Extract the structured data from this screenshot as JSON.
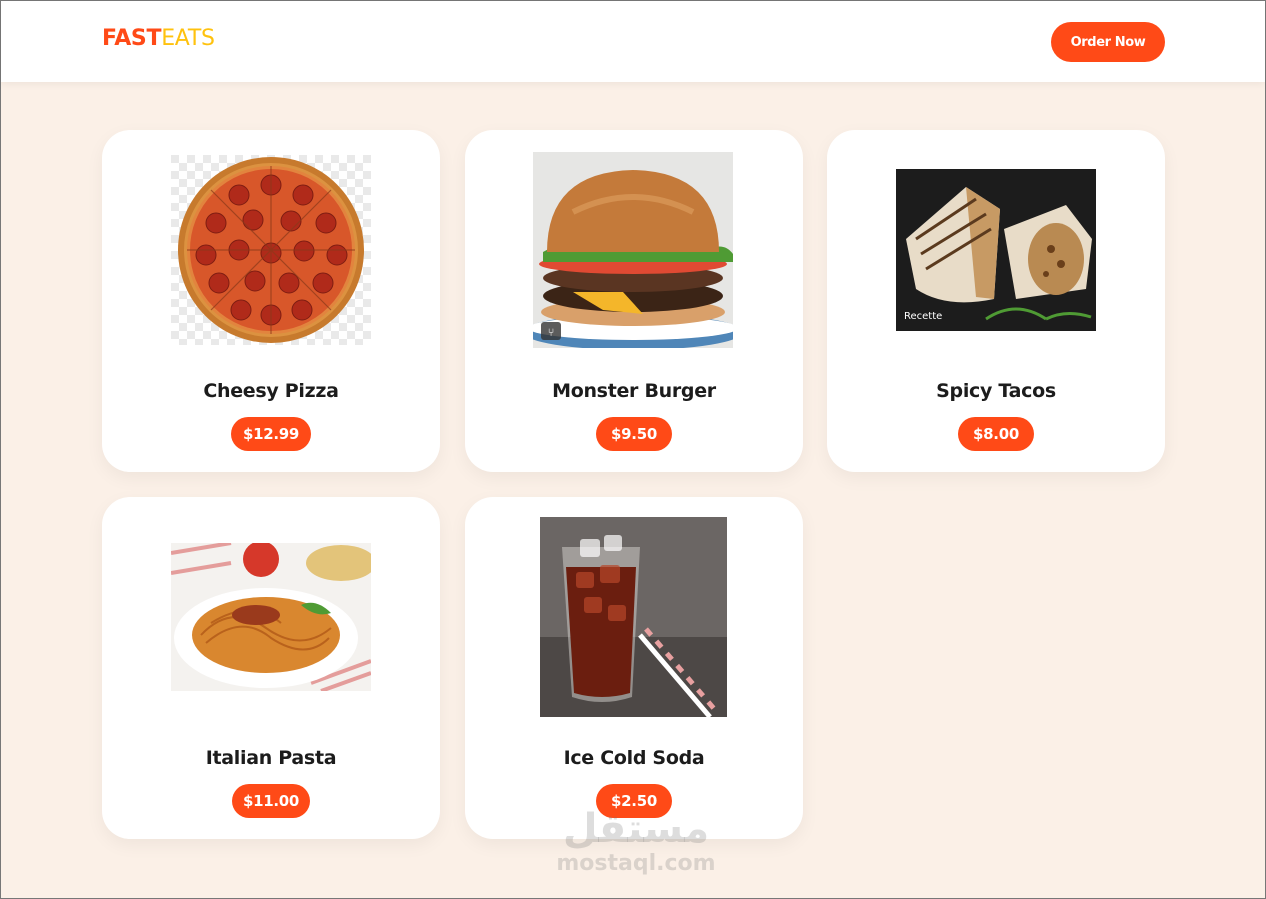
{
  "brand": {
    "part1": "FAST",
    "part2": "EATS"
  },
  "nav": {
    "order_label": "Order Now"
  },
  "menu": [
    {
      "name": "Cheesy Pizza",
      "price": "$12.99",
      "icon": "pizza-image"
    },
    {
      "name": "Monster Burger",
      "price": "$9.50",
      "icon": "burger-image"
    },
    {
      "name": "Spicy Tacos",
      "price": "$8.00",
      "icon": "tacos-image",
      "badge": "Recette"
    },
    {
      "name": "Italian Pasta",
      "price": "$11.00",
      "icon": "pasta-image"
    },
    {
      "name": "Ice Cold Soda",
      "price": "$2.50",
      "icon": "soda-image"
    }
  ],
  "watermark": {
    "arabic": "مستقل",
    "latin": "mostaql.com"
  },
  "colors": {
    "accent": "#ff4a17",
    "accent2": "#ffc20e",
    "background": "#fbf0e7"
  }
}
